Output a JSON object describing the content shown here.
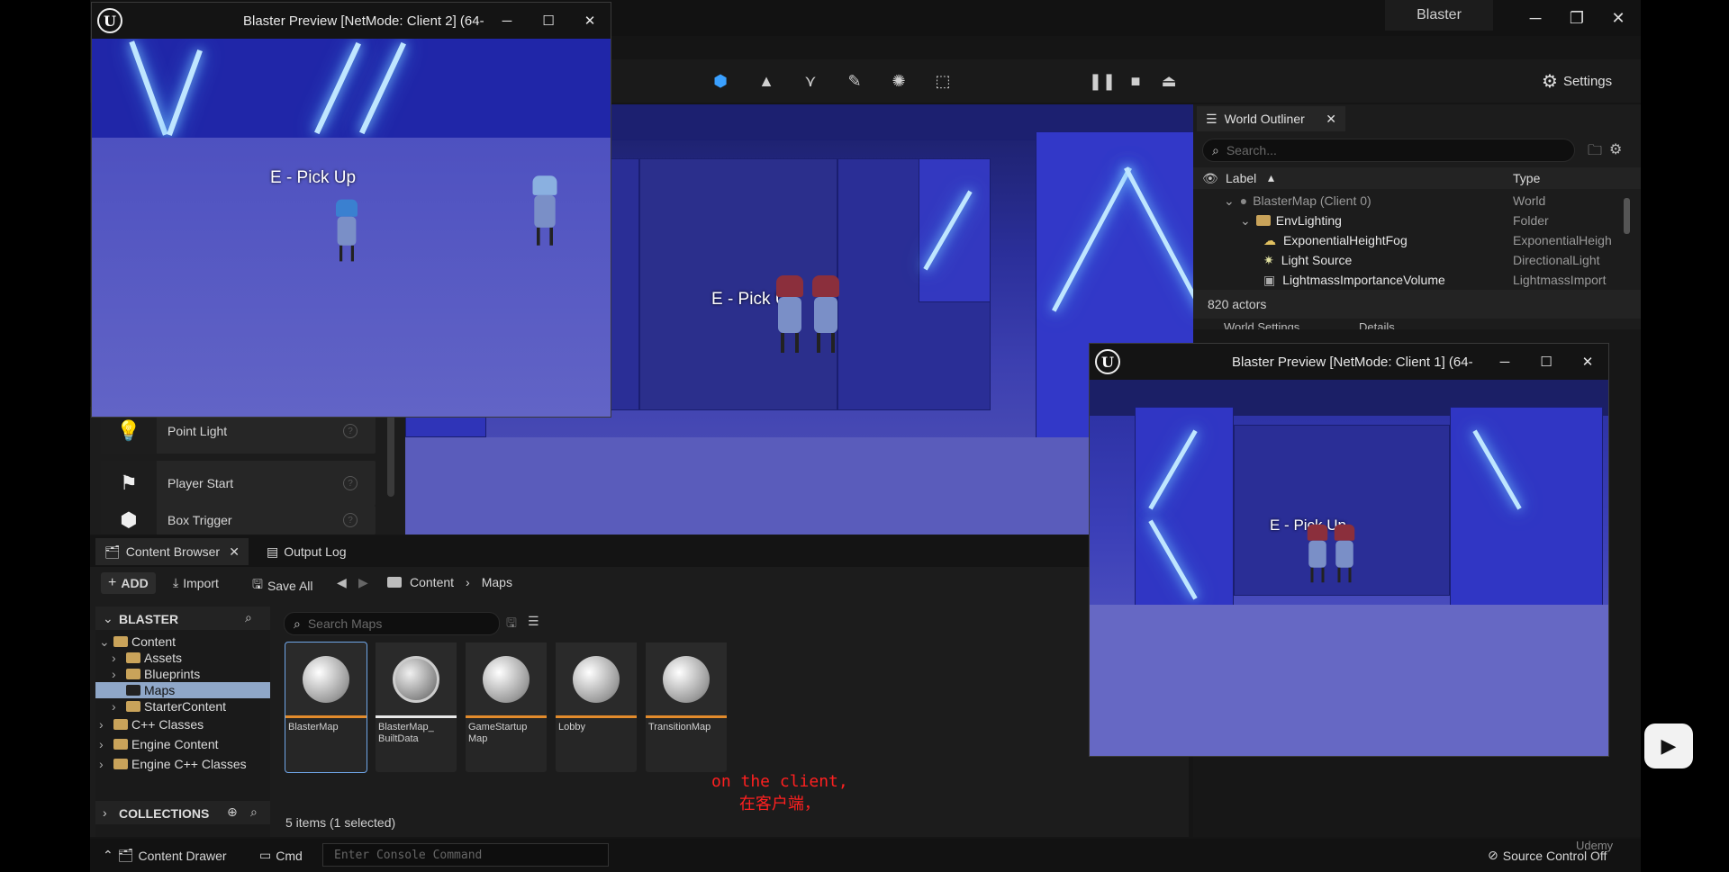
{
  "editor": {
    "project_name": "Blaster",
    "settings_label": "Settings",
    "viewport_prompt": "E - Pick Up"
  },
  "place_actors": {
    "items": [
      {
        "label": "Point Light",
        "icon": "bulb-icon"
      },
      {
        "label": "Player Start",
        "icon": "flag-icon"
      },
      {
        "label": "Box Trigger",
        "icon": "cube-icon"
      }
    ]
  },
  "outliner": {
    "tab_label": "World Outliner",
    "search_placeholder": "Search...",
    "col_label": "Label",
    "col_type": "Type",
    "rows": [
      {
        "label": "BlasterMap (Client 0)",
        "type": "World"
      },
      {
        "label": "EnvLighting",
        "type": "Folder"
      },
      {
        "label": "ExponentialHeightFog",
        "type": "ExponentialHeigh"
      },
      {
        "label": "Light Source",
        "type": "DirectionalLight"
      },
      {
        "label": "LightmassImportanceVolume",
        "type": "LightmassImport"
      }
    ],
    "count": "820 actors",
    "world_settings": "World Settings",
    "details": "Details"
  },
  "content_browser": {
    "tab_label": "Content Browser",
    "output_log_label": "Output Log",
    "add_label": "ADD",
    "import_label": "Import",
    "save_all_label": "Save All",
    "breadcrumb": [
      "Content",
      "Maps"
    ],
    "root_label": "BLASTER",
    "search_placeholder": "Search Maps",
    "tree": [
      {
        "label": "Content",
        "level": 0,
        "expanded": true
      },
      {
        "label": "Assets",
        "level": 1
      },
      {
        "label": "Blueprints",
        "level": 1
      },
      {
        "label": "Maps",
        "level": 1,
        "selected": true
      },
      {
        "label": "StarterContent",
        "level": 1
      },
      {
        "label": "C++ Classes",
        "level": 0
      },
      {
        "label": "Engine Content",
        "level": 0
      },
      {
        "label": "Engine C++ Classes",
        "level": 0
      }
    ],
    "collections_label": "COLLECTIONS",
    "assets": [
      {
        "name": "BlasterMap",
        "kind": "map"
      },
      {
        "name": "BlasterMap_ BuiltData",
        "kind": "data"
      },
      {
        "name": "GameStartup Map",
        "kind": "map"
      },
      {
        "name": "Lobby",
        "kind": "map"
      },
      {
        "name": "TransitionMap",
        "kind": "map"
      }
    ],
    "status": "5 items (1 selected)"
  },
  "statusbar": {
    "content_drawer": "Content Drawer",
    "cmd": "Cmd",
    "console_placeholder": "Enter Console Command",
    "source_control": "Source Control Off",
    "watermark": "Udemy"
  },
  "preview_client2": {
    "title": "Blaster Preview [NetMode: Client 2]  (64-",
    "prompt": "E - Pick Up"
  },
  "preview_client1": {
    "title": "Blaster Preview [NetMode: Client 1]  (64-",
    "prompt": "E - Pick Up"
  },
  "subtitles": {
    "en": "on the client,",
    "zh": "在客户端，"
  },
  "colors": {
    "accent": "#e28b2c",
    "selection": "#8fa7c8",
    "subtitle": "#ff2020"
  }
}
